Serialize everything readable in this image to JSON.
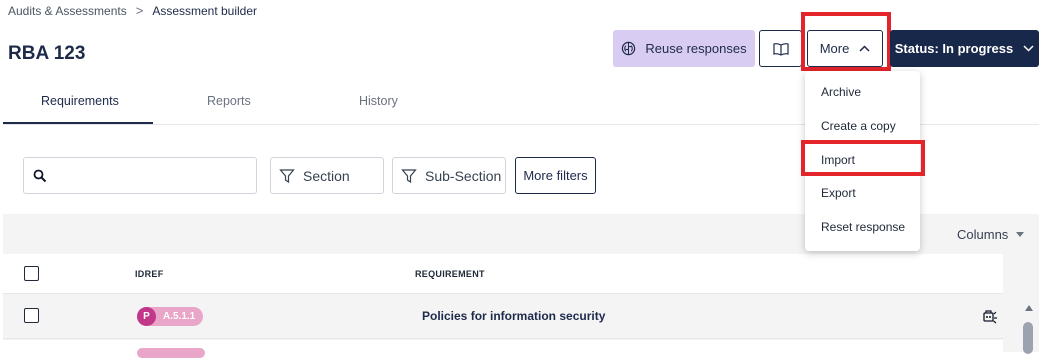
{
  "breadcrumb": {
    "parent": "Audits & Assessments",
    "separator": ">",
    "current": "Assessment builder"
  },
  "page": {
    "title": "RBA 123"
  },
  "toolbar": {
    "reuse_label": "Reuse responses",
    "more_label": "More",
    "status_label": "Status: In progress"
  },
  "tabs": [
    {
      "label": "Requirements",
      "active": true
    },
    {
      "label": "Reports",
      "active": false
    },
    {
      "label": "History",
      "active": false
    }
  ],
  "filters": {
    "search_placeholder": "",
    "section_label": "Section",
    "subsection_label": "Sub-Section",
    "more_filters_label": "More filters"
  },
  "table": {
    "columns_label": "Columns",
    "headers": {
      "idref": "IDREF",
      "requirement": "REQUIREMENT"
    },
    "rows": [
      {
        "badge_letter": "P",
        "idref": "A.5.1.1",
        "requirement": "Policies for information security"
      }
    ]
  },
  "more_menu": {
    "items": [
      {
        "label": "Archive"
      },
      {
        "label": "Create a copy"
      },
      {
        "label": "Import"
      },
      {
        "label": "Export"
      },
      {
        "label": "Reset response"
      }
    ]
  },
  "colors": {
    "primary": "#18284a",
    "accent_purple": "#d9ccf3",
    "highlight_red": "#e3242b",
    "badge_pink": "#c2378a"
  },
  "icons": [
    "chevron-right-icon",
    "brain-icon",
    "book-icon",
    "chevron-up-icon",
    "chevron-down-icon",
    "search-icon",
    "filter-icon",
    "caret-down-icon",
    "ai-assist-icon"
  ]
}
